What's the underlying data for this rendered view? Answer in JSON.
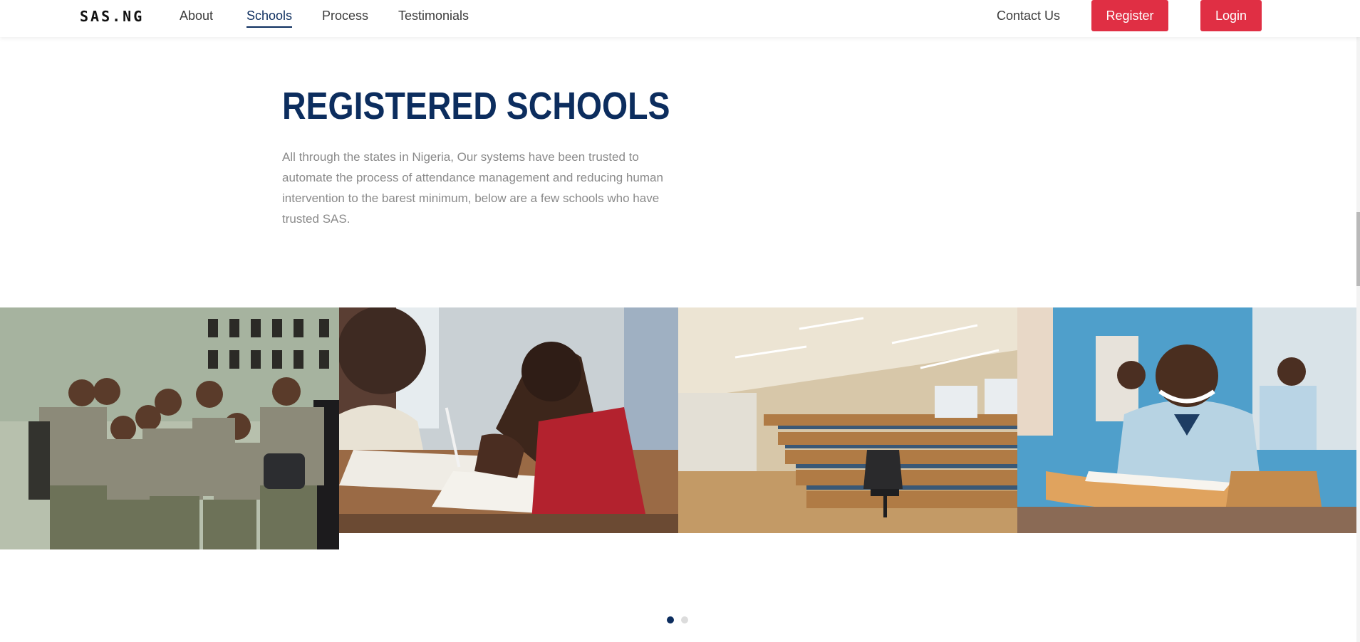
{
  "nav": {
    "brand": "SAS.NG",
    "links": [
      {
        "label": "About"
      },
      {
        "label": "Schools"
      },
      {
        "label": "Process"
      },
      {
        "label": "Testimonials"
      }
    ],
    "contact_label": "Contact Us",
    "register_label": "Register",
    "login_label": "Login"
  },
  "section": {
    "title": "REGISTERED SCHOOLS",
    "description": "All through the states in Nigeria, Our systems have been trusted to automate the process of attendance management and reducing human intervention to the barest minimum, below are a few schools who have trusted SAS."
  },
  "gallery": {
    "photos": [
      {
        "icon": "students-group-photo"
      },
      {
        "icon": "students-writing-photo"
      },
      {
        "icon": "lecture-hall-photo"
      },
      {
        "icon": "smiling-student-photo"
      }
    ]
  },
  "carousel": {
    "page_count": 2,
    "active_page": 1
  },
  "colors": {
    "primary": "#0c2d5e",
    "accent": "#e02f44",
    "text_muted": "#8a8a8a"
  }
}
